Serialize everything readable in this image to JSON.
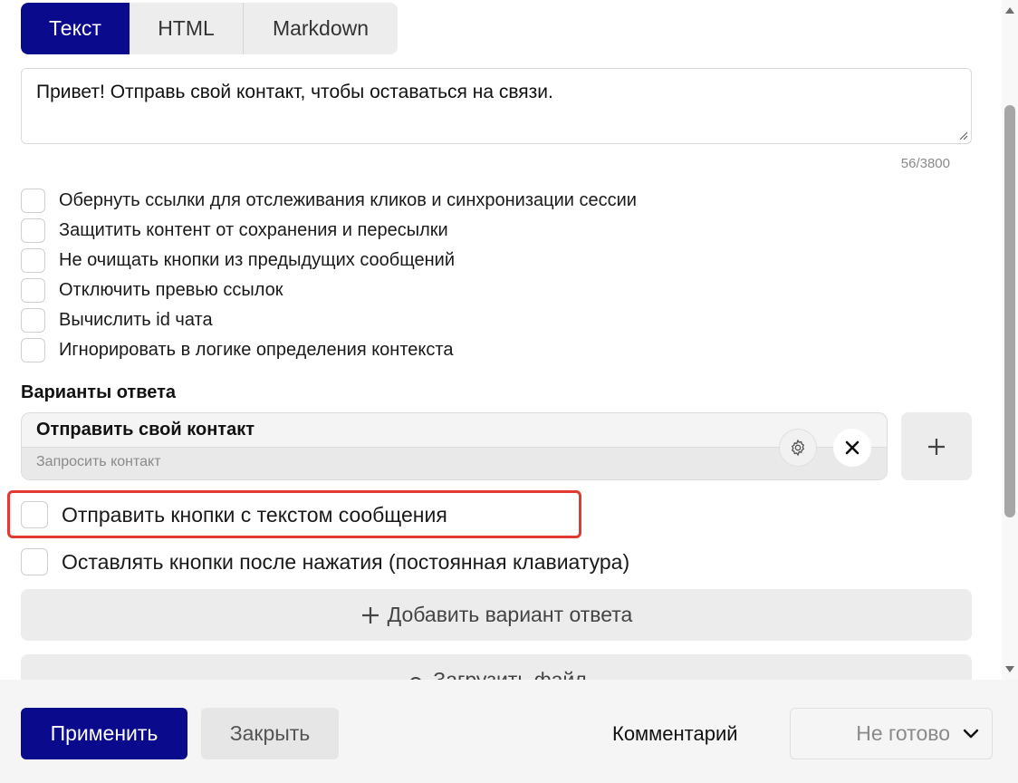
{
  "tabs": [
    "Текст",
    "HTML",
    "Markdown"
  ],
  "message": {
    "text": "Привет! Отправь свой контакт, чтобы оставаться на связи.",
    "counter": "56/3800"
  },
  "options": [
    "Обернуть ссылки для отслеживания кликов и синхронизации сессии",
    "Защитить контент от сохранения и пересылки",
    "Не очищать кнопки из предыдущих сообщений",
    "Отключить превью ссылок",
    "Вычислить id чата",
    "Игнорировать в логике определения контекста"
  ],
  "answers": {
    "section_title": "Варианты ответа",
    "items": [
      {
        "title": "Отправить свой контакт",
        "subtitle": "Запросить контакт"
      }
    ]
  },
  "button_options": [
    "Отправить кнопки с текстом сообщения",
    "Оставлять кнопки после нажатия (постоянная клавиатура)"
  ],
  "actions": {
    "add_answer": "Добавить вариант ответа",
    "upload_file": "Загрузить файл"
  },
  "footer": {
    "apply": "Применить",
    "close": "Закрыть",
    "comment": "Комментарий",
    "status": "Не готово"
  },
  "colors": {
    "primary": "#0a0a8c",
    "highlight": "#e03a32"
  }
}
